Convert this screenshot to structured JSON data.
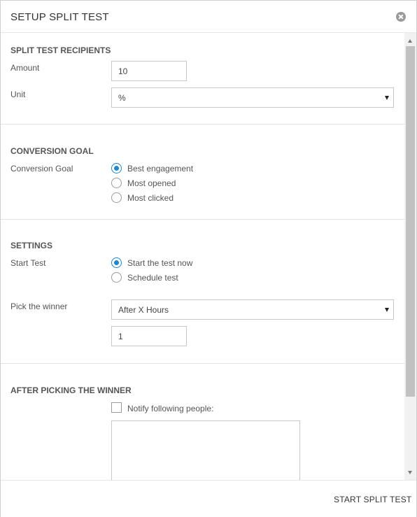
{
  "dialog": {
    "title": "SETUP SPLIT TEST",
    "close_icon": "close-circle-icon"
  },
  "recipients": {
    "heading": "SPLIT TEST RECIPIENTS",
    "amount_label": "Amount",
    "amount_value": "10",
    "unit_label": "Unit",
    "unit_value": "%"
  },
  "conversion": {
    "heading": "CONVERSION GOAL",
    "label": "Conversion Goal",
    "options": [
      {
        "label": "Best engagement",
        "checked": true
      },
      {
        "label": "Most opened",
        "checked": false
      },
      {
        "label": "Most clicked",
        "checked": false
      }
    ]
  },
  "settings": {
    "heading": "SETTINGS",
    "start_label": "Start Test",
    "start_options": [
      {
        "label": "Start the test now",
        "checked": true
      },
      {
        "label": "Schedule test",
        "checked": false
      }
    ],
    "winner_label": "Pick the winner",
    "winner_value": "After X Hours",
    "hours_value": "1"
  },
  "after": {
    "heading": "AFTER PICKING THE WINNER",
    "notify_label": "Notify following people:",
    "notify_checked": false,
    "people_value": ""
  },
  "footer": {
    "start_button": "START SPLIT TEST"
  },
  "colors": {
    "accent": "#1b87d6",
    "scrollbar_thumb": "#c1c1c1"
  }
}
